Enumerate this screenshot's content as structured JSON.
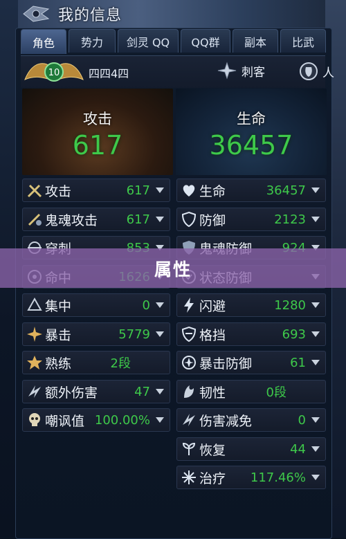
{
  "window": {
    "title": "我的信息"
  },
  "tabs": [
    {
      "label": "角色",
      "active": true
    },
    {
      "label": "势力",
      "active": false
    },
    {
      "label": "剑灵 QQ",
      "active": false
    },
    {
      "label": "QQ群",
      "active": false
    },
    {
      "label": "副本",
      "active": false
    },
    {
      "label": "比武",
      "active": false
    }
  ],
  "player": {
    "level": "10",
    "name": "四四4四",
    "class": "刺客",
    "gender": "人"
  },
  "summary": {
    "attack_label": "攻击",
    "attack_value": "617",
    "life_label": "生命",
    "life_value": "36457"
  },
  "left_stats": [
    {
      "label": "攻击",
      "value": "617",
      "icon": "swords-icon",
      "dropdown": true
    },
    {
      "label": "鬼魂攻击",
      "value": "617",
      "icon": "ghost-sword-icon",
      "dropdown": true
    },
    {
      "label": "穿刺",
      "value": "853",
      "icon": "pierce-icon",
      "dropdown": true
    },
    {
      "label": "命中",
      "value": "1626",
      "icon": "target-icon",
      "dropdown": true
    },
    {
      "label": "集中",
      "value": "0",
      "icon": "focus-icon",
      "dropdown": true
    },
    {
      "label": "暴击",
      "value": "5779",
      "icon": "critical-icon",
      "dropdown": true
    },
    {
      "label": "熟练",
      "value": "2段",
      "icon": "star-icon",
      "dropdown": false
    },
    {
      "label": "额外伤害",
      "value": "47",
      "icon": "extra-damage-icon",
      "dropdown": true
    },
    {
      "label": "嘲讽值",
      "value": "100.00%",
      "icon": "skull-icon",
      "dropdown": true
    }
  ],
  "right_stats": [
    {
      "label": "生命",
      "value": "36457",
      "icon": "heart-icon",
      "dropdown": true
    },
    {
      "label": "防御",
      "value": "2123",
      "icon": "shield-icon",
      "dropdown": true
    },
    {
      "label": "鬼魂防御",
      "value": "924",
      "icon": "ghost-shield-icon",
      "dropdown": true
    },
    {
      "label": "状态防御",
      "value": "",
      "icon": "status-defense-icon",
      "dropdown": true
    },
    {
      "label": "闪避",
      "value": "1280",
      "icon": "lightning-icon",
      "dropdown": true
    },
    {
      "label": "格挡",
      "value": "693",
      "icon": "block-icon",
      "dropdown": true
    },
    {
      "label": "暴击防御",
      "value": "61",
      "icon": "crit-defense-icon",
      "dropdown": true
    },
    {
      "label": "韧性",
      "value": "0段",
      "icon": "toughness-icon",
      "dropdown": false
    },
    {
      "label": "伤害减免",
      "value": "0",
      "icon": "damage-reduction-icon",
      "dropdown": true
    },
    {
      "label": "恢复",
      "value": "44",
      "icon": "recovery-icon",
      "dropdown": true
    },
    {
      "label": "治疗",
      "value": "117.46%",
      "icon": "healing-icon",
      "dropdown": true
    }
  ],
  "banner": {
    "text": "属性"
  },
  "colors": {
    "value_green": "#3ec94a",
    "banner_purple": "#8c64aa"
  }
}
